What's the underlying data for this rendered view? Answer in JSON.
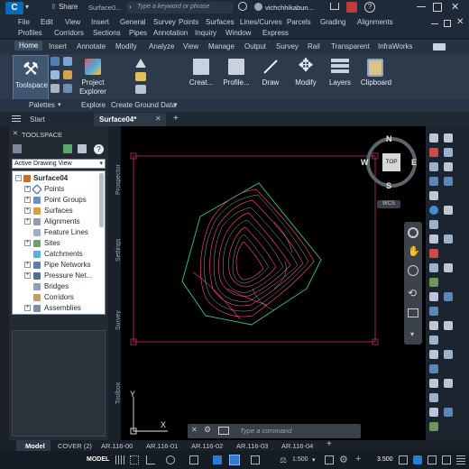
{
  "title": {
    "app_letter": "C",
    "share_label": "Share",
    "doc_name": "Surface0...",
    "search_placeholder": "Type a keyword or phrase",
    "user_name": "vichchhikabun..."
  },
  "menu": {
    "row1": [
      "File",
      "Edit",
      "View",
      "Insert",
      "General",
      "Survey",
      "Points",
      "Surfaces",
      "Lines/Curves",
      "Parcels",
      "Grading",
      "Alignments"
    ],
    "row2": [
      "Profiles",
      "Corridors",
      "Sections",
      "Pipes",
      "Annotation",
      "Inquiry",
      "Window",
      "Express"
    ]
  },
  "ribbon_tabs": [
    "Home",
    "Insert",
    "Annotate",
    "Modify",
    "Analyze",
    "View",
    "Manage",
    "Output",
    "Survey",
    "Rail",
    "Transparent",
    "InfraWorks"
  ],
  "ribbon": {
    "toolspace": "Toolspace",
    "project_explorer": [
      "Project",
      "Explorer"
    ],
    "create": "Creat...",
    "profile": "Profile...",
    "draw": "Draw",
    "modify": "Modify",
    "layers": "Layers",
    "clipboard": "Clipboard",
    "palettes_panel": "Palettes",
    "explore_panel": "Explore",
    "create_ground_panel": "Create Ground Data"
  },
  "doc_tabs": {
    "start": "Start",
    "active": "Surface04*",
    "add": "+"
  },
  "toolspace": {
    "title": "TOOLSPACE",
    "view_selector": "Active Drawing View",
    "root": "Surface04",
    "items": [
      "Points",
      "Point Groups",
      "Surfaces",
      "Alignments",
      "Feature Lines",
      "Sites",
      "Catchments",
      "Pipe Networks",
      "Pressure Net...",
      "Bridges",
      "Corridors",
      "Assemblies"
    ],
    "side_tabs": [
      "Prospector",
      "Settings",
      "Survey",
      "Toolbox"
    ]
  },
  "viewcube": {
    "n": "N",
    "s": "S",
    "e": "E",
    "w": "W",
    "top": "TOP",
    "wcs": "WCS"
  },
  "ucs": {
    "x": "X",
    "y": "Y"
  },
  "command": {
    "placeholder": "Type a command"
  },
  "layout_tabs": [
    "Model",
    "COVER (2)",
    "AR.116-00",
    "AR.116-01",
    "AR.116-02",
    "AR.116-03",
    "AR.116-04",
    "+"
  ],
  "status": {
    "model": "MODEL",
    "scale": "1:500",
    "value": "3.500"
  },
  "colors": {
    "accent": "#2e7bd6",
    "contour_major": "#e0447a",
    "contour_minor": "#d8d8d8",
    "boundary": "#3fc57f"
  }
}
